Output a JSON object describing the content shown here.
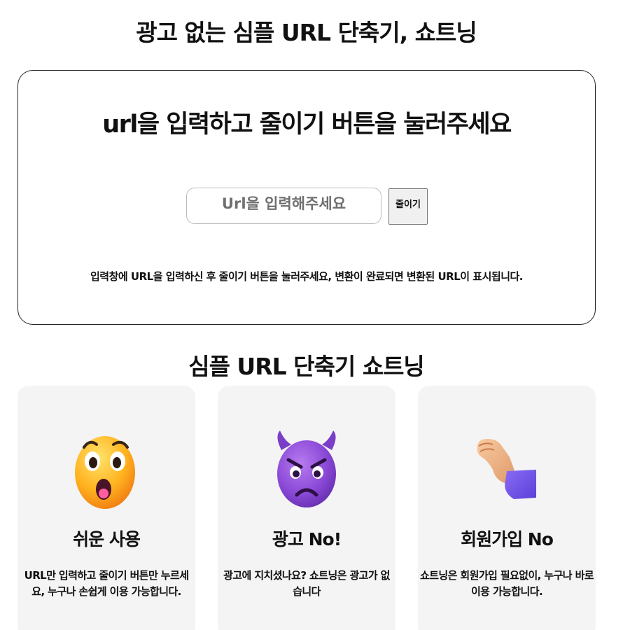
{
  "header": {
    "title": "광고 없는 심플 URL 단축기, 쇼트닝"
  },
  "main_card": {
    "heading": "url을 입력하고 줄이기 버튼을 눌러주세요",
    "input": {
      "placeholder": "Url을 입력해주세요",
      "value": ""
    },
    "button_label": "줄이기",
    "instructions": "입력창에 URL을 입력하신 후 줄이기 버튼을 눌러주세요, 변환이 완료되면 변환된 URL이 표시됩니다."
  },
  "features_section": {
    "title": "심플 URL 단축기 쇼트닝",
    "cards": [
      {
        "icon": "astonished-face-icon",
        "title": "쉬운 사용",
        "desc": "URL만 입력하고 줄이기 버튼만 누르세요, 누구나 손쉽게 이용 가능합니다."
      },
      {
        "icon": "angry-devil-face-icon",
        "title": "광고 No!",
        "desc": "광고에 지치셨나요? 쇼트닝은 광고가 없습니다"
      },
      {
        "icon": "raised-back-of-hand-icon",
        "title": "회원가입 No",
        "desc": "쇼트닝은 회원가입 필요없이, 누구나 바로 이용 가능합니다."
      }
    ]
  },
  "colors": {
    "card_border": "#222222",
    "feature_card_bg": "#f4f4f4",
    "button_bg": "#f0f0f0",
    "input_border": "#bdbdbd"
  }
}
